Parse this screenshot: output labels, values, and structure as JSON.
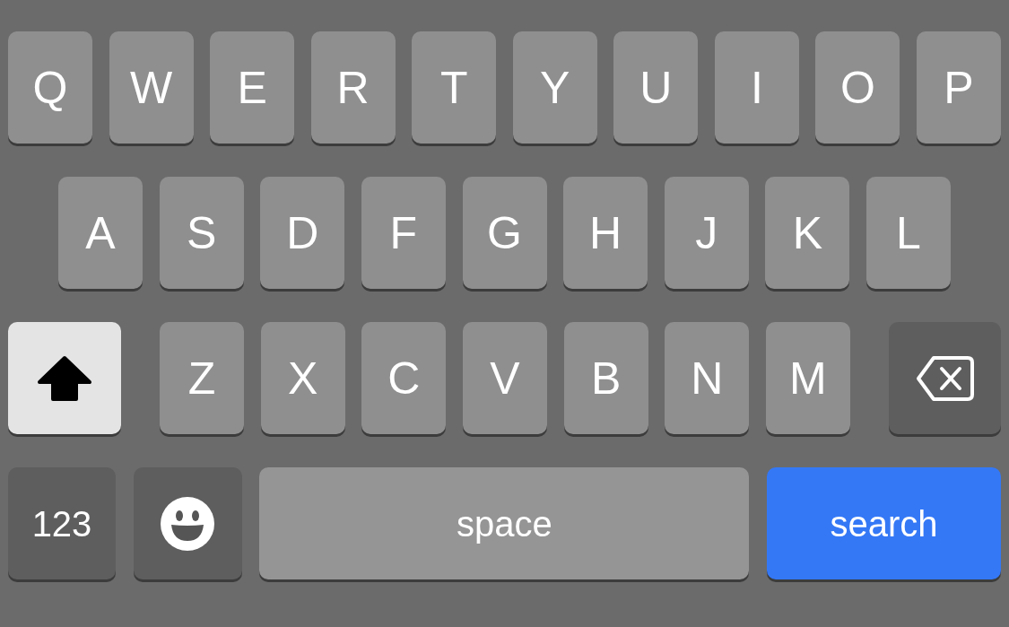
{
  "keyboard": {
    "rows": [
      {
        "keys": [
          {
            "kind": "letter",
            "label": "Q"
          },
          {
            "kind": "letter",
            "label": "W"
          },
          {
            "kind": "letter",
            "label": "E"
          },
          {
            "kind": "letter",
            "label": "R"
          },
          {
            "kind": "letter",
            "label": "T"
          },
          {
            "kind": "letter",
            "label": "Y"
          },
          {
            "kind": "letter",
            "label": "U"
          },
          {
            "kind": "letter",
            "label": "I"
          },
          {
            "kind": "letter",
            "label": "O"
          },
          {
            "kind": "letter",
            "label": "P"
          }
        ]
      },
      {
        "keys": [
          {
            "kind": "letter",
            "label": "A"
          },
          {
            "kind": "letter",
            "label": "S"
          },
          {
            "kind": "letter",
            "label": "D"
          },
          {
            "kind": "letter",
            "label": "F"
          },
          {
            "kind": "letter",
            "label": "G"
          },
          {
            "kind": "letter",
            "label": "H"
          },
          {
            "kind": "letter",
            "label": "J"
          },
          {
            "kind": "letter",
            "label": "K"
          },
          {
            "kind": "letter",
            "label": "L"
          }
        ]
      },
      {
        "keys": [
          {
            "kind": "shift",
            "on": true
          },
          {
            "kind": "letter",
            "label": "Z"
          },
          {
            "kind": "letter",
            "label": "X"
          },
          {
            "kind": "letter",
            "label": "C"
          },
          {
            "kind": "letter",
            "label": "V"
          },
          {
            "kind": "letter",
            "label": "B"
          },
          {
            "kind": "letter",
            "label": "N"
          },
          {
            "kind": "letter",
            "label": "M"
          },
          {
            "kind": "backspace"
          }
        ]
      },
      {
        "keys": [
          {
            "kind": "numbers",
            "label": "123"
          },
          {
            "kind": "emoji"
          },
          {
            "kind": "space",
            "label": "space"
          },
          {
            "kind": "return",
            "label": "search"
          }
        ]
      }
    ]
  }
}
